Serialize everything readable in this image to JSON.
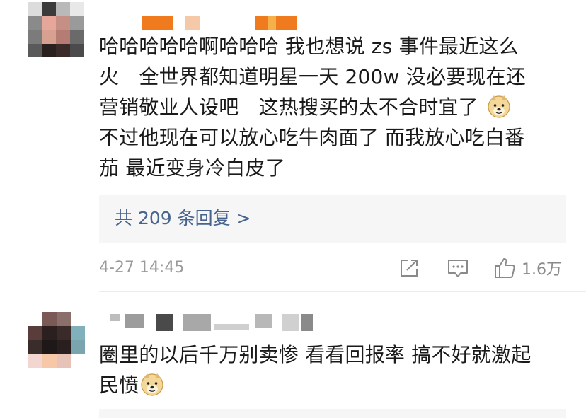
{
  "comments": [
    {
      "text_lines": [
        "哈哈哈哈哈啊哈哈哈 我也想说 zs 事件最近这么",
        "火　全世界都知道明星一天 200w 没必要现在还",
        "营销敬业人设吧　这热搜买的太不合时宜了",
        "不过他现在可以放心吃牛肉面了 而我放心吃白番",
        "茄 最近变身冷白皮了"
      ],
      "emoji_icon": "doge-emoji-icon",
      "replies_label": "共 209 条回复 >",
      "time": "4-27 14:45",
      "like_count": "1.6万",
      "actions": [
        "share-icon",
        "comment-icon",
        "like-icon"
      ]
    },
    {
      "text_lines": [
        "圈里的以后千万别卖惨 看看回报率 搞不好就激起",
        "民愤"
      ],
      "emoji_icon": "doge-emoji-icon"
    }
  ],
  "colors": {
    "text": "#1a1a1a",
    "link": "#48648e",
    "meta": "#9a9a9a",
    "reply_bg": "#f6f6f6",
    "username_blur": "#f07a1e"
  }
}
